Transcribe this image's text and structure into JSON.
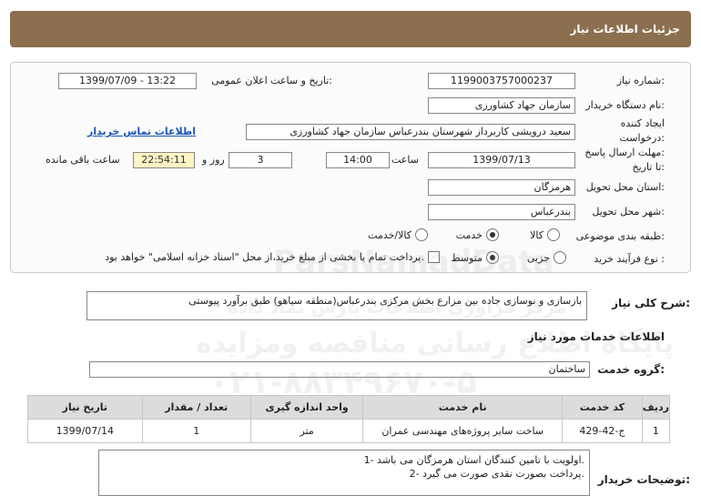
{
  "header": {
    "title": "جزئیات اطلاعات نیاز"
  },
  "form": {
    "need_number": {
      "label": "شماره نیاز:",
      "value": "1199003757000237"
    },
    "announce_datetime": {
      "label": "تاریخ و ساعت اعلان عمومی:",
      "value": "1399/07/09 - 13:22"
    },
    "buyer_org": {
      "label": "نام دستگاه خریدار:",
      "value": "سازمان جهاد کشاورزی"
    },
    "requester": {
      "label_line1": "ایجاد کننده",
      "label_line2": "درخواست:",
      "value": "سعید درویشی کاربرداز شهرستان بندرعباس سازمان جهاد کشاورزی",
      "contact_link": "اطلاعات تماس خریدار"
    },
    "deadline": {
      "label_line1": "مهلت ارسال پاسخ:",
      "label_line2": "تا تاریخ:",
      "date": "1399/07/13",
      "time_label": "ساعت",
      "time": "14:00",
      "days": "3",
      "days_label": "روز و",
      "remaining": "22:54:11",
      "remaining_label": "ساعت باقی مانده"
    },
    "province": {
      "label": "استان محل تحویل:",
      "value": "هرمزگان"
    },
    "city": {
      "label": "شهر محل تحویل:",
      "value": "بندرعباس"
    },
    "category": {
      "label": "طبقه بندی موضوعی:",
      "options": [
        "کالا",
        "خدمت",
        "کالا/خدمت"
      ],
      "selected": "خدمت"
    },
    "process": {
      "label": "نوع فرآیند خرید :",
      "options": [
        "جزیی",
        "متوسط"
      ],
      "selected": "متوسط",
      "payment_note": "پرداخت تمام یا بخشی از مبلغ خرید،از محل \"اسناد خزانه اسلامی\" خواهد بود."
    }
  },
  "summary": {
    "label": "شرح کلی نیاز:",
    "value": "بازسازی و نوسازی جاده بین مزارع بخش مرکزی بندرعباس(منطقه سیاهو) طبق برآورد پیوستی"
  },
  "services_title": "اطلاعات خدمات مورد نیاز",
  "service_group": {
    "label": "گروه خدمت:",
    "value": "ساختمان"
  },
  "table": {
    "headers": [
      "ردیف",
      "کد خدمت",
      "نام خدمت",
      "واحد اندازه گیری",
      "تعداد / مقدار",
      "تاریخ نیاز"
    ],
    "rows": [
      [
        "1",
        "ج-42-429",
        "ساخت سایر پروژه‌های مهندسی عمران",
        "متر",
        "1",
        "1399/07/14"
      ]
    ]
  },
  "buyer_notes": {
    "label": "توضیحات خریدار:",
    "lines": [
      "1- اولویت با تامین کنندگان استان هرمزگان می باشد.",
      "2- پرداخت بصورت نقدی صورت می گیرد."
    ]
  },
  "watermarks": {
    "brand": "ParsNamadData",
    "site": "پایگاه اطلاع رسانی مناقصه ومزایده",
    "subtitle": "مرکز فراوری اطلاعات پارس نماد داده",
    "phone": "۰۲۱-۸۸۳۴۹۶۷۰-۵"
  }
}
